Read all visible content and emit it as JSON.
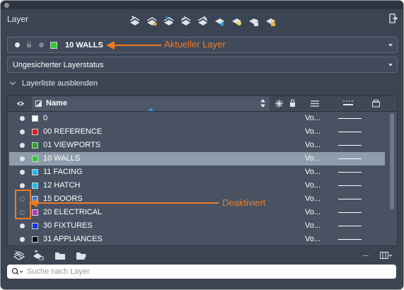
{
  "panel": {
    "title": "Layer"
  },
  "current_layer": {
    "name": "10 WALLS",
    "color": "#2ecc2e"
  },
  "layer_state": {
    "value": "Ungesicherter Layerstatus"
  },
  "layer_list": {
    "collapse_label": "Layerliste ausblenden"
  },
  "table": {
    "header": {
      "name": "Name"
    },
    "rows": [
      {
        "name": "0",
        "color": "#ffffff",
        "on": true,
        "linetype": "Vo...",
        "selected": false
      },
      {
        "name": "00 REFERENCE",
        "color": "#e01b1b",
        "on": true,
        "linetype": "Vo...",
        "selected": false
      },
      {
        "name": "01 VIEWPORTS",
        "color": "#2aa52a",
        "on": true,
        "linetype": "Vo...",
        "selected": false
      },
      {
        "name": "10 WALLS",
        "color": "#2ecc2e",
        "on": true,
        "linetype": "Vo...",
        "selected": true
      },
      {
        "name": "11 FACING",
        "color": "#1fb8f0",
        "on": true,
        "linetype": "Vo...",
        "selected": false
      },
      {
        "name": "12 HATCH",
        "color": "#1fb8f0",
        "on": true,
        "linetype": "Vo...",
        "selected": false
      },
      {
        "name": "15 DOORS",
        "color": "#2a7fe0",
        "on": false,
        "linetype": "Vo...",
        "selected": false
      },
      {
        "name": "20 ELECTRICAL",
        "color": "#b93ac2",
        "on": false,
        "linetype": "Vo...",
        "selected": false
      },
      {
        "name": "30 FIXTURES",
        "color": "#1438e0",
        "on": true,
        "linetype": "Vo...",
        "selected": false
      },
      {
        "name": "31 APPLIANCES",
        "color": "#0a0a0a",
        "on": true,
        "linetype": "Vo...",
        "selected": false
      }
    ]
  },
  "search": {
    "placeholder": "Suche nach Layer"
  },
  "annotations": {
    "current_layer": "Aktueller Layer",
    "deactivated": "Deaktiviert",
    "color": "#f07b23"
  },
  "icons": {
    "toolbar": [
      "new-layer-icon",
      "layer-properties-icon",
      "layer-match-icon",
      "layer-previous-icon",
      "make-current-icon",
      "freeze-icon",
      "on-off-icon",
      "lock-icon",
      "unlock-icon"
    ],
    "columns": [
      "visibility-icon",
      "freeze-column-icon",
      "lock-column-icon",
      "linetype-column-icon",
      "lineweight-column-icon",
      "plot-column-icon"
    ],
    "bottom": [
      "new-layer-icon",
      "new-layer-frozen-icon",
      "folder-icon",
      "folder-open-icon",
      "minus-icon",
      "columns-menu-icon"
    ]
  }
}
